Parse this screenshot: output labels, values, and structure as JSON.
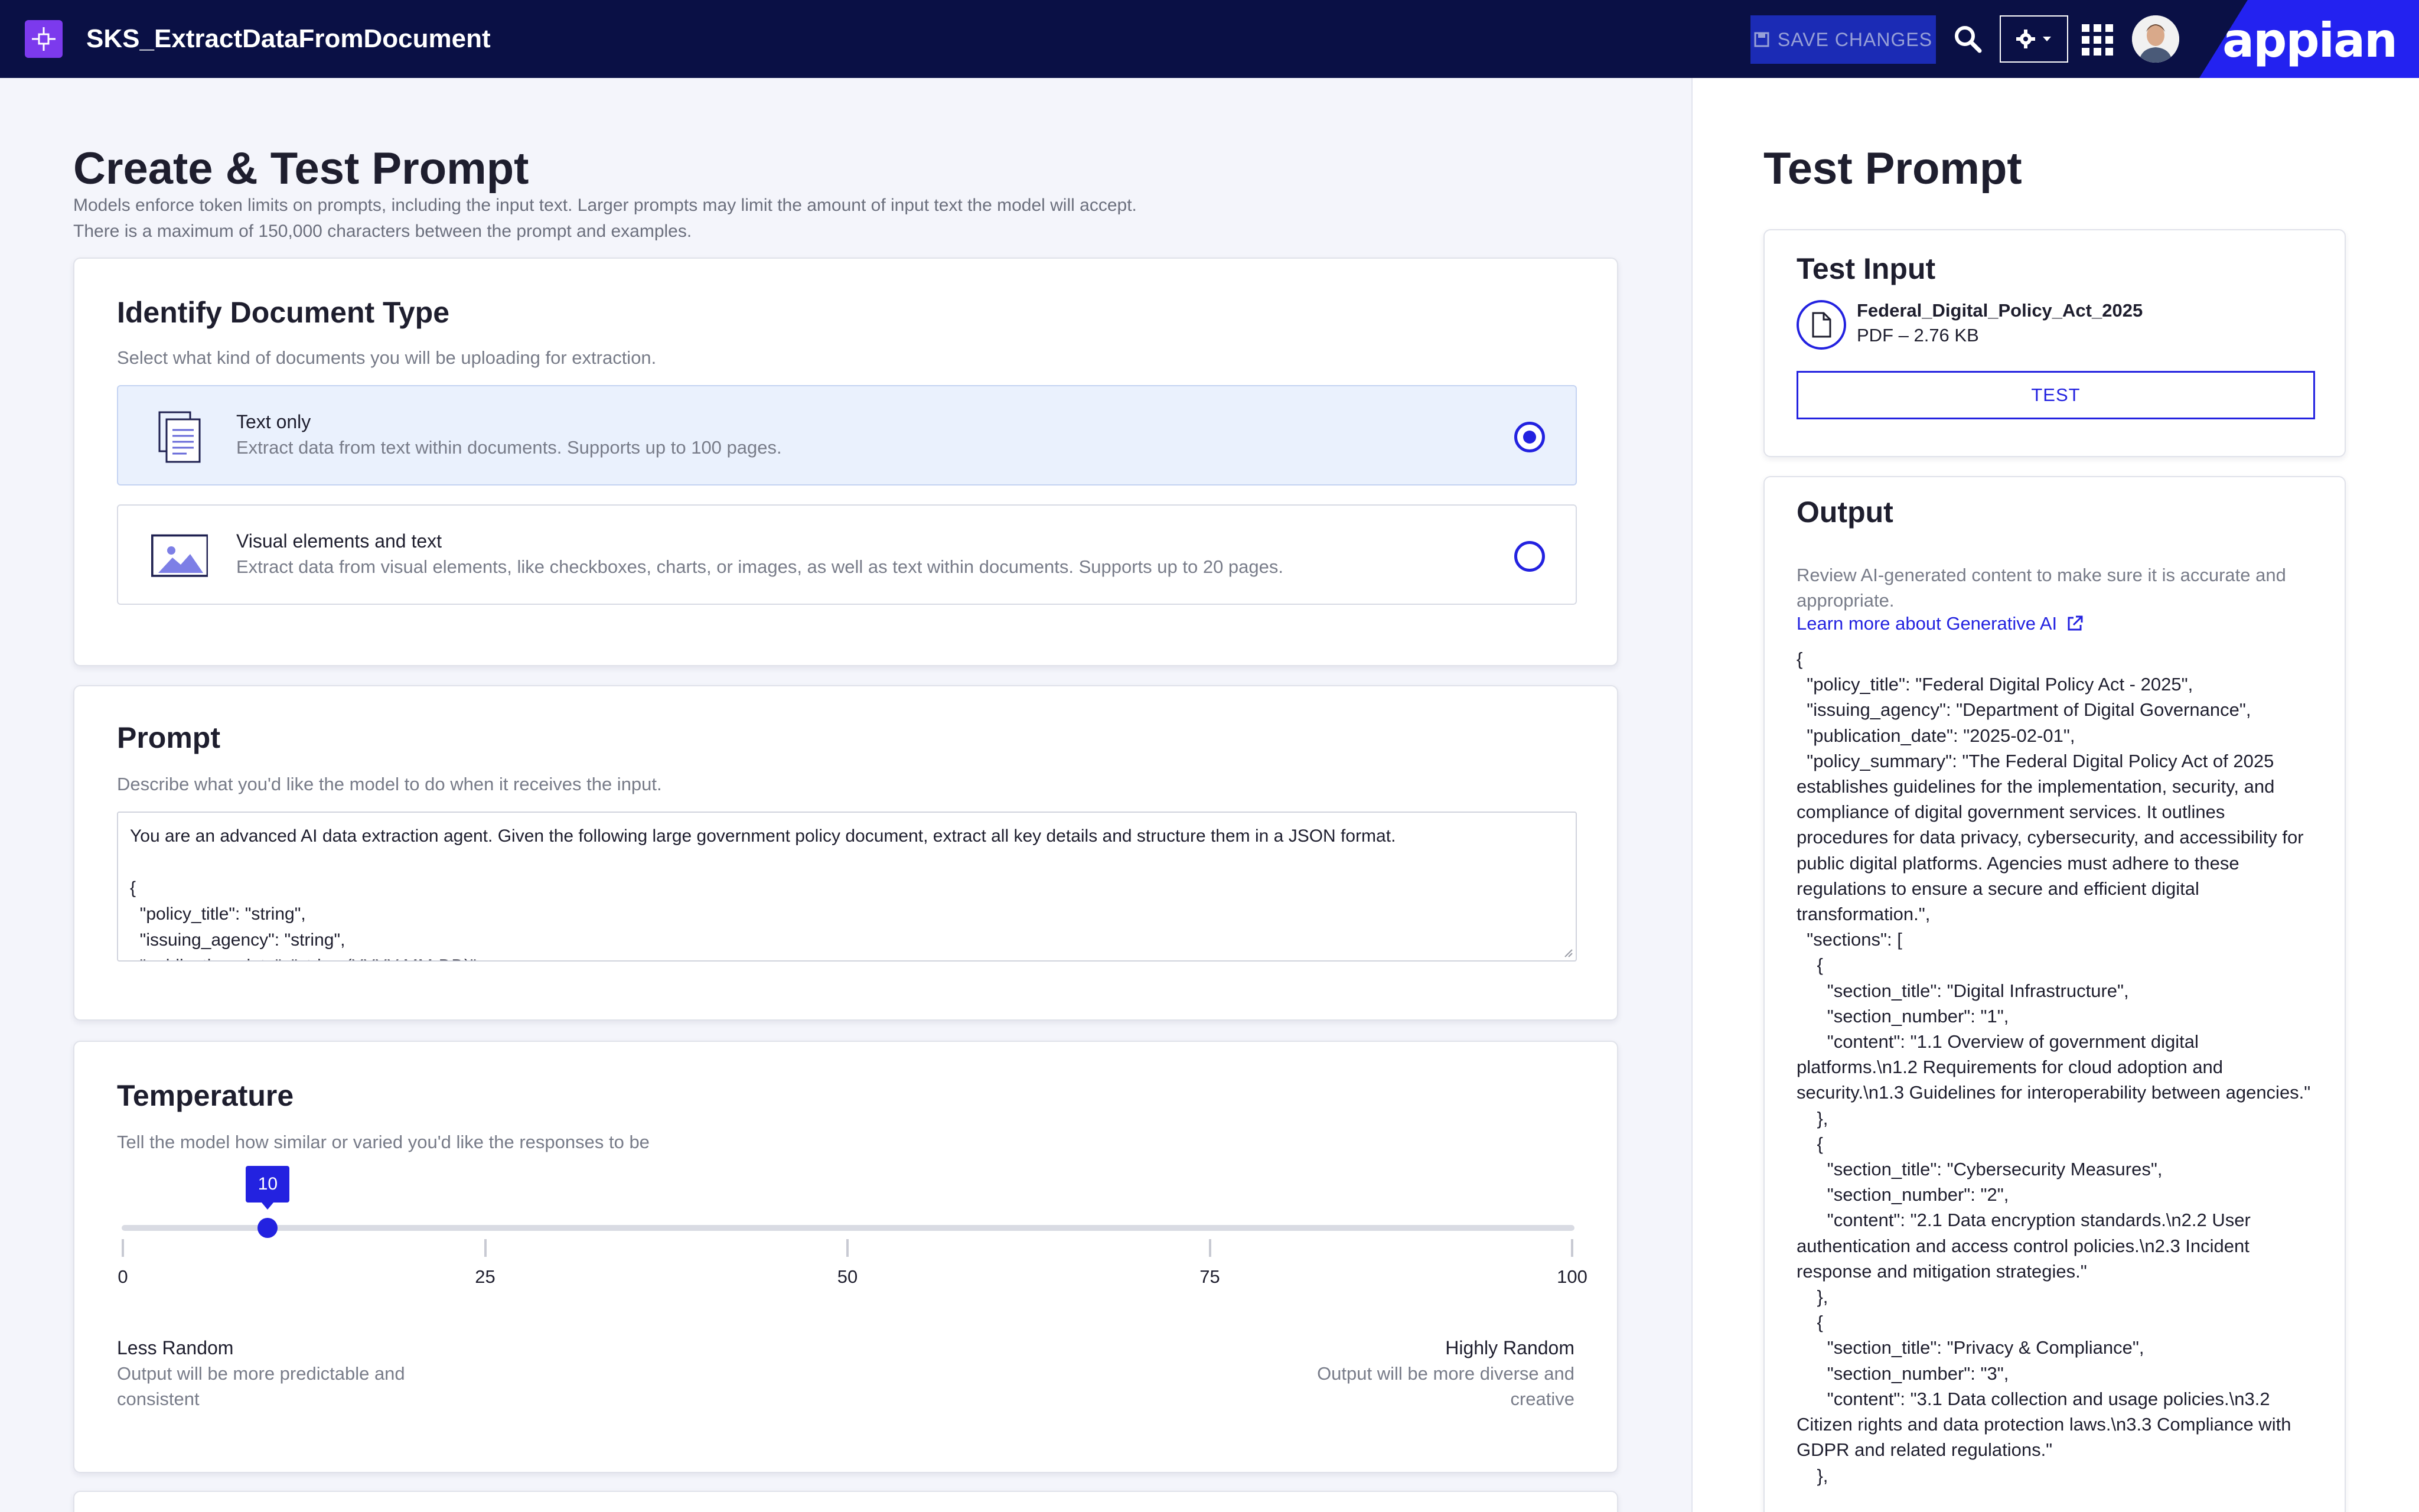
{
  "header": {
    "app_title": "SKS_ExtractDataFromDocument",
    "save_label": "SAVE CHANGES",
    "brand": "appian",
    "icons": [
      "app-logo-icon",
      "save-icon",
      "search-icon",
      "gear-icon",
      "chevron-down-icon",
      "apps-grid-icon",
      "avatar"
    ]
  },
  "colors": {
    "topbar": "#0a1045",
    "accent": "#2322e0",
    "selected_option": "#eaf1fd",
    "app_logo": "#7c3aed"
  },
  "main": {
    "title": "Create & Test Prompt",
    "desc_line1": "Models enforce token limits on prompts, including the input text. Larger prompts may limit the amount of input text the model will accept.",
    "desc_line2": "There is a maximum of 150,000 characters between the prompt and examples."
  },
  "doc_type": {
    "title": "Identify Document Type",
    "desc": "Select what kind of documents you will be uploading for extraction.",
    "options": [
      {
        "label": "Text only",
        "desc": "Extract data from text within documents. Supports up to 100 pages.",
        "selected": true,
        "icon": "document-text-icon"
      },
      {
        "label": "Visual elements and text",
        "desc": "Extract data from visual elements, like checkboxes, charts, or images, as well as text within documents. Supports up to 20 pages.",
        "selected": false,
        "icon": "image-icon"
      }
    ]
  },
  "prompt": {
    "title": "Prompt",
    "desc": "Describe what you'd like the model to do when it receives the input.",
    "value": "You are an advanced AI data extraction agent. Given the following large government policy document, extract all key details and structure them in a JSON format.\n\n{\n  \"policy_title\": \"string\",\n  \"issuing_agency\": \"string\",\n  \"publication_date\": \"string (YYYY-MM-DD)\","
  },
  "temperature": {
    "title": "Temperature",
    "desc": "Tell the model how similar or varied you'd like the responses to be",
    "value": 10,
    "value_label": "10",
    "min": 0,
    "max": 100,
    "ticks": [
      "0",
      "25",
      "50",
      "75",
      "100"
    ],
    "low_label": "Less Random",
    "low_desc": "Output will be more predictable and consistent",
    "high_label": "Highly Random",
    "high_desc": "Output will be more diverse and creative"
  },
  "test": {
    "title": "Test Prompt",
    "input_title": "Test Input",
    "file_name": "Federal_Digital_Policy_Act_2025",
    "file_meta": "PDF – 2.76 KB",
    "test_label": "TEST",
    "output_title": "Output",
    "output_desc": "Review AI-generated content to make sure it is accurate and appropriate.",
    "learn_more": "Learn more about Generative AI",
    "output_text": "{\n  \"policy_title\": \"Federal Digital Policy Act - 2025\",\n  \"issuing_agency\": \"Department of Digital Governance\",\n  \"publication_date\": \"2025-02-01\",\n  \"policy_summary\": \"The Federal Digital Policy Act of 2025 establishes guidelines for the implementation, security, and compliance of digital government services. It outlines procedures for data privacy, cybersecurity, and accessibility for public digital platforms. Agencies must adhere to these regulations to ensure a secure and efficient digital transformation.\",\n  \"sections\": [\n    {\n      \"section_title\": \"Digital Infrastructure\",\n      \"section_number\": \"1\",\n      \"content\": \"1.1 Overview of government digital platforms.\\n1.2 Requirements for cloud adoption and security.\\n1.3 Guidelines for interoperability between agencies.\"\n    },\n    {\n      \"section_title\": \"Cybersecurity Measures\",\n      \"section_number\": \"2\",\n      \"content\": \"2.1 Data encryption standards.\\n2.2 User authentication and access control policies.\\n2.3 Incident response and mitigation strategies.\"\n    },\n    {\n      \"section_title\": \"Privacy & Compliance\",\n      \"section_number\": \"3\",\n      \"content\": \"3.1 Data collection and usage policies.\\n3.2 Citizen rights and data protection laws.\\n3.3 Compliance with GDPR and related regulations.\"\n    },"
  }
}
